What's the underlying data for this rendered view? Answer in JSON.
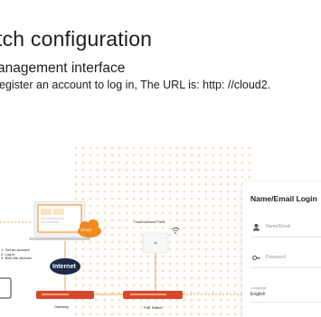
{
  "document": {
    "heading": "tch configuration",
    "subheading": "anagement interface",
    "instruction": "egister an account to log in,  The URL is: http: //cloud2."
  },
  "diagram": {
    "cloud_label": "Cloud",
    "internet_label": "Internet",
    "access_point_label": "Cloud Access Point",
    "gateway_label": "Gateway",
    "poe_switch_label": "PoE Switch",
    "steps": [
      "1. Get an account",
      "2. Log in",
      "3. Bind the devices"
    ]
  },
  "login_card": {
    "title": "Name/Email Login",
    "name_placeholder": "Name/Email",
    "password_placeholder": "Password",
    "language_label": "Language",
    "language_value": "English"
  },
  "colors": {
    "accent_orange": "#f08a1d",
    "device_red": "#d9472b",
    "internet_navy": "#1e2a4a",
    "text_dark": "#1d1d1d"
  }
}
